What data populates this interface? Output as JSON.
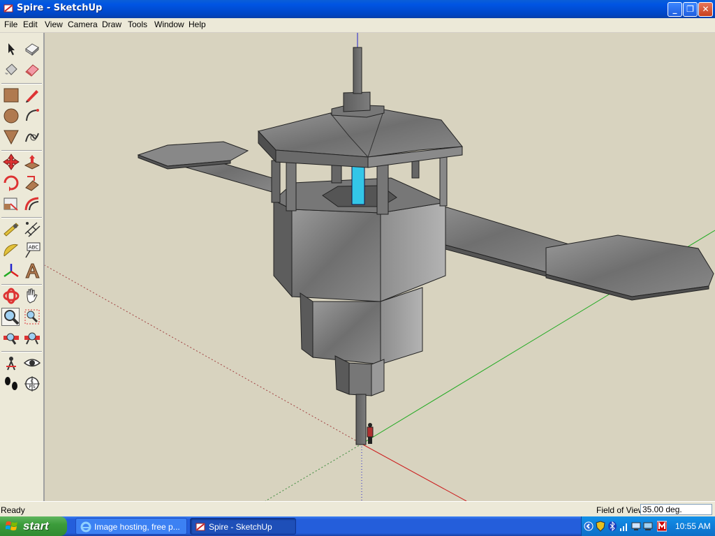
{
  "window": {
    "title": "Spire - SketchUp",
    "min_glyph": "_",
    "max_glyph": "❐",
    "close_glyph": "✕"
  },
  "menu": [
    "File",
    "Edit",
    "View",
    "Camera",
    "Draw",
    "Tools",
    "Window",
    "Help"
  ],
  "toolbar": {
    "tools": [
      {
        "name": "select-tool",
        "icon": "arrow-icon"
      },
      {
        "name": "make-component-tool",
        "icon": "component-icon"
      },
      {
        "name": "paint-bucket-tool",
        "icon": "paint-bucket-icon"
      },
      {
        "name": "eraser-tool",
        "icon": "eraser-icon"
      },
      {
        "name": "rectangle-tool",
        "icon": "rectangle-icon"
      },
      {
        "name": "line-tool",
        "icon": "pencil-icon"
      },
      {
        "name": "circle-tool",
        "icon": "circle-icon"
      },
      {
        "name": "arc-tool",
        "icon": "arc-icon"
      },
      {
        "name": "polygon-tool",
        "icon": "triangle-icon"
      },
      {
        "name": "freehand-tool",
        "icon": "freehand-icon"
      },
      {
        "name": "move-tool",
        "icon": "move-arrows-icon"
      },
      {
        "name": "push-pull-tool",
        "icon": "push-pull-icon"
      },
      {
        "name": "rotate-tool",
        "icon": "rotate-icon"
      },
      {
        "name": "follow-me-tool",
        "icon": "follow-me-icon"
      },
      {
        "name": "scale-tool",
        "icon": "scale-icon"
      },
      {
        "name": "offset-tool",
        "icon": "offset-icon"
      },
      {
        "name": "tape-measure-tool",
        "icon": "tape-measure-icon"
      },
      {
        "name": "dimension-tool",
        "icon": "dimension-icon"
      },
      {
        "name": "protractor-tool",
        "icon": "protractor-icon"
      },
      {
        "name": "text-tool",
        "icon": "text-label-icon"
      },
      {
        "name": "axes-tool",
        "icon": "axes-icon"
      },
      {
        "name": "3d-text-tool",
        "icon": "3d-text-icon"
      },
      {
        "name": "orbit-tool",
        "icon": "orbit-icon"
      },
      {
        "name": "pan-tool",
        "icon": "hand-icon"
      },
      {
        "name": "zoom-tool",
        "icon": "magnifier-icon"
      },
      {
        "name": "zoom-window-tool",
        "icon": "zoom-window-icon"
      },
      {
        "name": "zoom-extents-tool",
        "icon": "zoom-extents-icon"
      },
      {
        "name": "previous-view-tool",
        "icon": "previous-view-icon"
      },
      {
        "name": "position-camera-tool",
        "icon": "position-camera-icon"
      },
      {
        "name": "look-around-tool",
        "icon": "eye-icon"
      },
      {
        "name": "walk-tool",
        "icon": "footprints-icon"
      },
      {
        "name": "section-plane-tool",
        "icon": "section-plane-icon"
      }
    ],
    "text_tool_glyph": "ABC",
    "section_glyph": "C\nP S",
    "active_tool": "zoom-tool"
  },
  "status": {
    "text": "Ready",
    "vcb_label": "Field of View",
    "vcb_value": "35.00 deg."
  },
  "taskbar": {
    "start_label": "start",
    "tasks": [
      {
        "label": "Image hosting, free p...",
        "icon": "internet-explorer-icon",
        "active": false
      },
      {
        "label": "Spire - SketchUp",
        "icon": "sketchup-icon",
        "active": true
      }
    ],
    "clock": "10:55 AM",
    "tray_icons": [
      "show-hidden-icon",
      "security-shield-icon",
      "bluetooth-icon",
      "signal-icon",
      "network-icon",
      "monitor-icon",
      "antivirus-icon"
    ]
  },
  "colors": {
    "viewport_bg": "#d8d3bf",
    "axis_red": "#cc2020",
    "axis_green": "#22aa22",
    "axis_blue": "#2020cc",
    "model_gray": "#7c7c7c",
    "glass_cyan": "#33c6e8"
  }
}
